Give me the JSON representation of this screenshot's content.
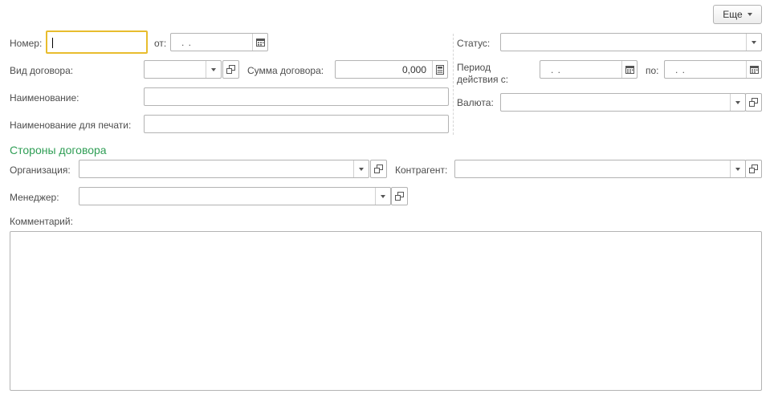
{
  "toolbar": {
    "more_label": "Еще"
  },
  "header": {
    "number_label": "Номер:",
    "number_value": "",
    "date_from_label": "от:",
    "date_mask": ". .",
    "status_label": "Статус:",
    "status_value": "",
    "contract_type_label": "Вид договора:",
    "contract_type_value": "",
    "contract_sum_label": "Сумма договора:",
    "contract_sum_value": "0,000",
    "period_label_line1": "Период",
    "period_label_line2": "действия с:",
    "period_from_mask": ". .",
    "period_to_label": "по:",
    "period_to_mask": ". .",
    "name_label": "Наименование:",
    "name_value": "",
    "currency_label": "Валюта:",
    "currency_value": "",
    "print_name_label": "Наименование для печати:",
    "print_name_value": ""
  },
  "parties": {
    "title": "Стороны договора",
    "organization_label": "Организация:",
    "organization_value": "",
    "counterparty_label": "Контрагент:",
    "counterparty_value": "",
    "manager_label": "Менеджер:",
    "manager_value": ""
  },
  "comment": {
    "label": "Комментарий:",
    "value": ""
  },
  "colors": {
    "section_title": "#2f9e55",
    "focus_border": "#e8bd2e",
    "border": "#b3b3b3"
  }
}
